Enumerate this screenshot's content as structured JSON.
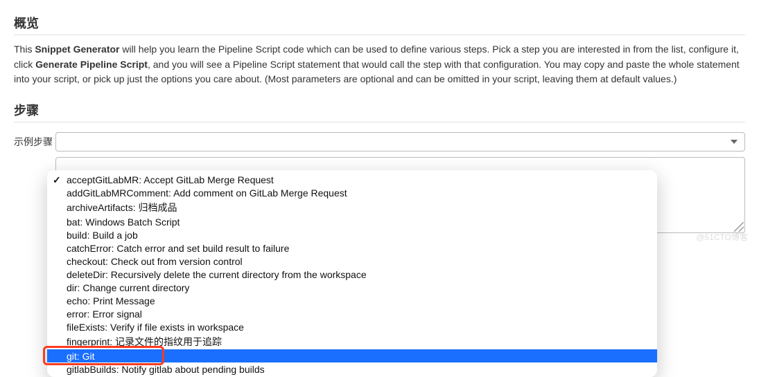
{
  "overview": {
    "heading": "概览",
    "text_pre": "This ",
    "text_b1": "Snippet Generator",
    "text_mid": " will help you learn the Pipeline Script code which can be used to define various steps. Pick a step you are interested in from the list, configure it, click ",
    "text_b2": "Generate Pipeline Script",
    "text_post": ", and you will see a Pipeline Script statement that would call the step with that configuration. You may copy and paste the whole statement into your script, or pick up just the options you care about. (Most parameters are optional and can be omitted in your script, leaving them at default values.)"
  },
  "steps": {
    "heading": "步骤",
    "label": "示例步骤"
  },
  "dropdown": {
    "options": [
      "acceptGitLabMR: Accept GitLab Merge Request",
      "addGitLabMRComment: Add comment on GitLab Merge Request",
      "archiveArtifacts: 归档成品",
      "bat: Windows Batch Script",
      "build: Build a job",
      "catchError: Catch error and set build result to failure",
      "checkout: Check out from version control",
      "deleteDir: Recursively delete the current directory from the workspace",
      "dir: Change current directory",
      "echo: Print Message",
      "error: Error signal",
      "fileExists: Verify if file exists in workspace",
      "fingerprint: 记录文件的指纹用于追踪",
      "git: Git",
      "gitlabBuilds: Notify gitlab about pending builds"
    ],
    "current_index": 0,
    "highlighted_index": 13
  },
  "watermark": "@51CTO博客"
}
